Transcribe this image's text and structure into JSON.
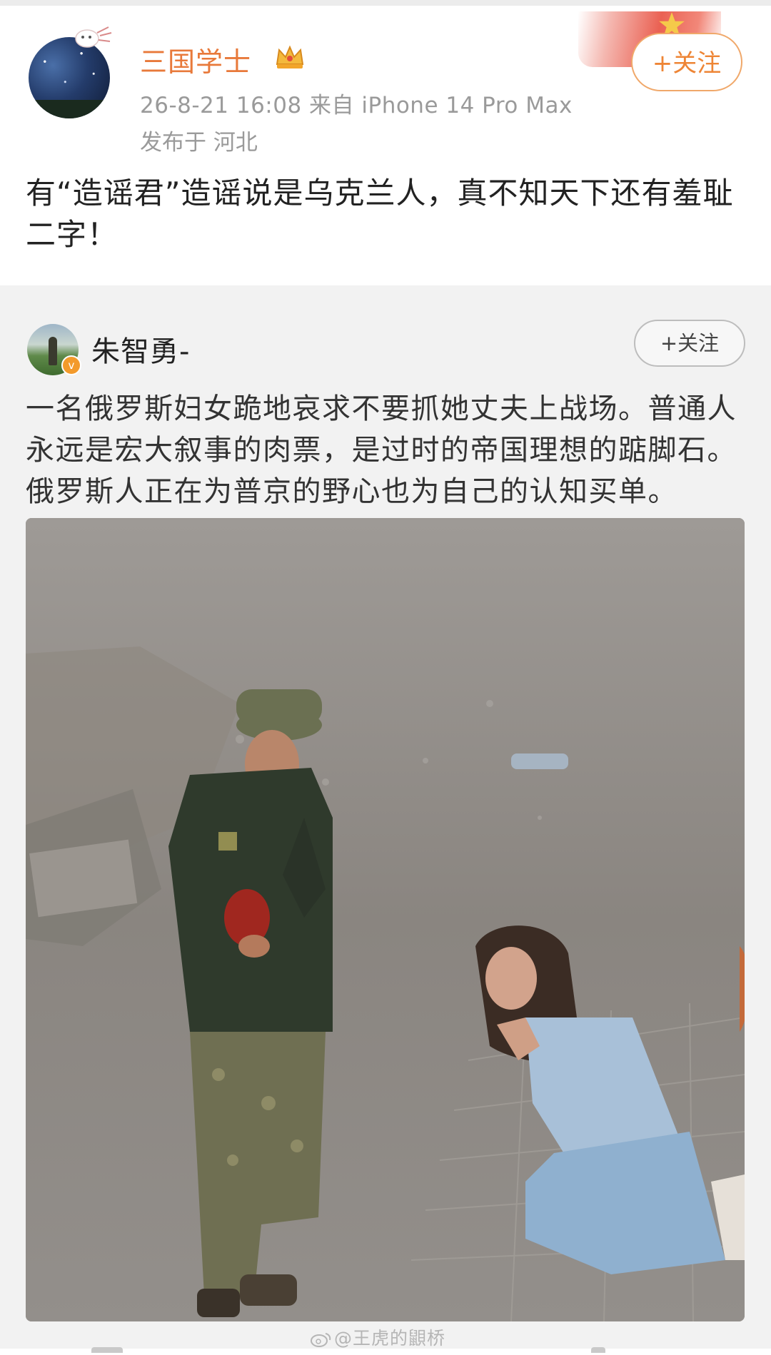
{
  "post": {
    "user": {
      "name": "三国学士",
      "verified_badge": "crown-icon"
    },
    "meta_line": "26-8-21 16:08  来自 iPhone 14 Pro Max",
    "location": "发布于 河北",
    "follow_label": "+关注",
    "text": "有“造谣君”造谣说是乌克兰人，真不知天下还有羞耻二字！"
  },
  "repost": {
    "user": {
      "name": "朱智勇-",
      "badge": "v"
    },
    "follow_label": "+关注",
    "text": "一名俄罗斯妇女跪地哀求不要抓她丈夫上战场。普通人永远是宏大叙事的肉票，是过时的帝国理想的踮脚石。俄罗斯人正在为普京的野心也为自己的认知买单。"
  },
  "watermark": "@王虎的鼰桥",
  "colors": {
    "username_orange": "#e8793a",
    "follow_orange": "#ee8535",
    "meta_gray": "#9a9a9a",
    "repost_bg": "#f2f2f2"
  }
}
